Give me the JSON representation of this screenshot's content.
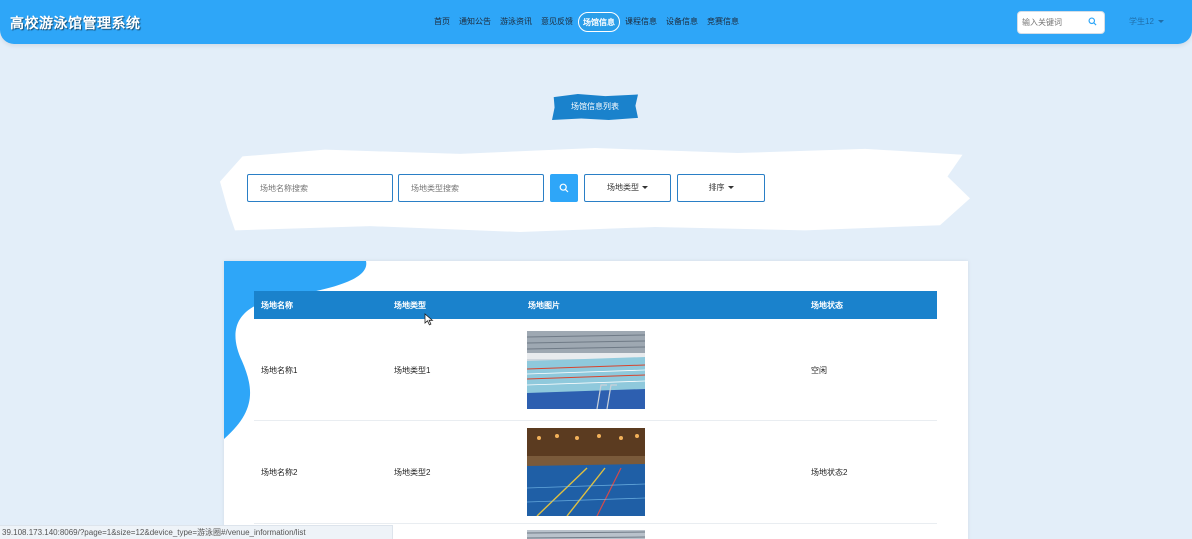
{
  "header": {
    "title": "高校游泳馆管理系统",
    "nav": [
      {
        "label": "首页",
        "active": false
      },
      {
        "label": "通知公告",
        "active": false
      },
      {
        "label": "游泳资讯",
        "active": false
      },
      {
        "label": "意见反馈",
        "active": false
      },
      {
        "label": "场馆信息",
        "active": true
      },
      {
        "label": "课程信息",
        "active": false
      },
      {
        "label": "设备信息",
        "active": false
      },
      {
        "label": "竞赛信息",
        "active": false
      }
    ],
    "search_placeholder": "输入关键词",
    "user": "学生12"
  },
  "page_title": "场馆信息列表",
  "filters": {
    "name_placeholder": "场地名称搜索",
    "type_placeholder": "场地类型搜索",
    "type_dropdown": "场地类型",
    "sort_dropdown": "排序"
  },
  "table": {
    "columns": [
      "场地名称",
      "场地类型",
      "场地图片",
      "场地状态"
    ],
    "rows": [
      {
        "name": "场地名称1",
        "type": "场地类型1",
        "image": "indoor-pool-photo",
        "status": "空闲"
      },
      {
        "name": "场地名称2",
        "type": "场地类型2",
        "image": "indoor-pool-night-photo",
        "status": "场地状态2"
      }
    ]
  },
  "status_url": "39.108.173.140:8069/?page=1&size=12&device_type=游泳圈#/venue_information/list",
  "colors": {
    "primary": "#2ea6f8",
    "table_header": "#1a82cc",
    "background": "#e3eef9"
  }
}
